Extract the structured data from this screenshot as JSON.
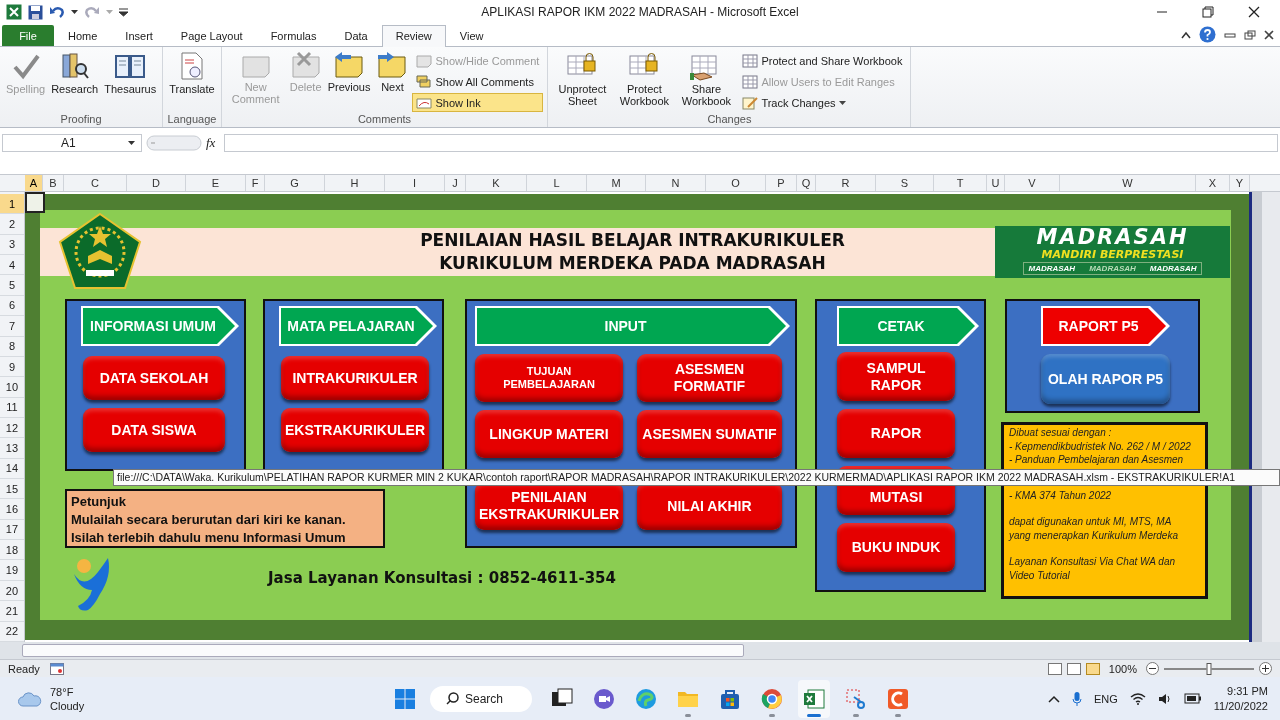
{
  "window": {
    "title": "APLIKASI RAPOR IKM 2022 MADRASAH  -  Microsoft Excel"
  },
  "ribbon": {
    "tabs": [
      {
        "label": "File",
        "kind": "file",
        "selected": false
      },
      {
        "label": "Home",
        "kind": "tab",
        "selected": false
      },
      {
        "label": "Insert",
        "kind": "tab",
        "selected": false
      },
      {
        "label": "Page Layout",
        "kind": "tab",
        "selected": false
      },
      {
        "label": "Formulas",
        "kind": "tab",
        "selected": false
      },
      {
        "label": "Data",
        "kind": "tab",
        "selected": false
      },
      {
        "label": "Review",
        "kind": "tab",
        "selected": true
      },
      {
        "label": "View",
        "kind": "tab",
        "selected": false
      }
    ],
    "groups": [
      {
        "label": "Proofing",
        "items": [
          {
            "label": "Spelling",
            "kind": "large",
            "disabled": true,
            "on": false
          },
          {
            "label": "Research",
            "kind": "large",
            "disabled": false,
            "on": false
          },
          {
            "label": "Thesaurus",
            "kind": "large",
            "disabled": false,
            "on": false
          }
        ]
      },
      {
        "label": "Language",
        "items": [
          {
            "label": "Translate",
            "kind": "large",
            "disabled": false,
            "on": false
          }
        ]
      },
      {
        "label": "Comments",
        "items": [
          {
            "label": "New Comment",
            "kind": "large",
            "disabled": true,
            "on": false
          },
          {
            "label": "Delete",
            "kind": "large",
            "disabled": true,
            "on": false
          },
          {
            "label": "Previous",
            "kind": "large",
            "disabled": false,
            "on": false
          },
          {
            "label": "Next",
            "kind": "large",
            "disabled": false,
            "on": false
          },
          {
            "label": "Show/Hide Comment",
            "kind": "small",
            "disabled": true,
            "on": false
          },
          {
            "label": "Show All Comments",
            "kind": "small",
            "disabled": false,
            "on": false
          },
          {
            "label": "Show Ink",
            "kind": "small",
            "disabled": false,
            "on": true
          }
        ]
      },
      {
        "label": "Changes",
        "items": [
          {
            "label": "Unprotect Sheet",
            "kind": "large",
            "disabled": false,
            "on": false
          },
          {
            "label": "Protect Workbook",
            "kind": "large",
            "disabled": false,
            "on": false
          },
          {
            "label": "Share Workbook",
            "kind": "large",
            "disabled": false,
            "on": false
          },
          {
            "label": "Protect and Share Workbook",
            "kind": "small",
            "disabled": false,
            "on": false
          },
          {
            "label": "Allow Users to Edit Ranges",
            "kind": "small",
            "disabled": true,
            "on": false
          },
          {
            "label": "Track Changes",
            "kind": "dropdown",
            "disabled": false,
            "on": false
          }
        ]
      }
    ]
  },
  "formula_bar": {
    "name_box": "A1",
    "function_label": "fx"
  },
  "sheet": {
    "columns": [
      {
        "label": "A",
        "selected": true
      },
      {
        "label": "B",
        "selected": false
      },
      {
        "label": "C",
        "selected": false
      },
      {
        "label": "D",
        "selected": false
      },
      {
        "label": "E",
        "selected": false
      },
      {
        "label": "F",
        "selected": false
      },
      {
        "label": "G",
        "selected": false
      },
      {
        "label": "H",
        "selected": false
      },
      {
        "label": "I",
        "selected": false
      },
      {
        "label": "J",
        "selected": false
      },
      {
        "label": "K",
        "selected": false
      },
      {
        "label": "L",
        "selected": false
      },
      {
        "label": "M",
        "selected": false
      },
      {
        "label": "N",
        "selected": false
      },
      {
        "label": "O",
        "selected": false
      },
      {
        "label": "P",
        "selected": false
      },
      {
        "label": "Q",
        "selected": false
      },
      {
        "label": "R",
        "selected": false
      },
      {
        "label": "S",
        "selected": false
      },
      {
        "label": "T",
        "selected": false
      },
      {
        "label": "U",
        "selected": false
      },
      {
        "label": "V",
        "selected": false
      },
      {
        "label": "W",
        "selected": false
      },
      {
        "label": "X",
        "selected": false
      },
      {
        "label": "Y",
        "selected": false
      }
    ],
    "rows": [
      {
        "label": "1",
        "selected": true
      },
      {
        "label": "2",
        "selected": false
      },
      {
        "label": "3",
        "selected": false
      },
      {
        "label": "4",
        "selected": false
      },
      {
        "label": "5",
        "selected": false
      },
      {
        "label": "6",
        "selected": false
      },
      {
        "label": "7",
        "selected": false
      },
      {
        "label": "8",
        "selected": false
      },
      {
        "label": "9",
        "selected": false
      },
      {
        "label": "10",
        "selected": false
      },
      {
        "label": "11",
        "selected": false
      },
      {
        "label": "12",
        "selected": false
      },
      {
        "label": "13",
        "selected": false
      },
      {
        "label": "14",
        "selected": false
      },
      {
        "label": "15",
        "selected": false
      },
      {
        "label": "16",
        "selected": false
      },
      {
        "label": "17",
        "selected": false
      },
      {
        "label": "18",
        "selected": false
      },
      {
        "label": "19",
        "selected": false
      },
      {
        "label": "20",
        "selected": false
      },
      {
        "label": "21",
        "selected": false
      },
      {
        "label": "22",
        "selected": false
      }
    ]
  },
  "dashboard": {
    "title_lines": [
      "PENILAIAN HASIL BELAJAR INTRAKURIKULER",
      "KURIKULUM MERDEKA PADA MADRASAH"
    ],
    "banner": {
      "title": "MADRASAH",
      "subtitle": "MANDIRI BERPRESTASI",
      "strip": [
        "MADRASAH",
        "MADRASAH",
        "MADRASAH"
      ]
    },
    "panels": [
      {
        "header": {
          "label": "INFORMASI  UMUM",
          "color": "#00a651"
        },
        "buttons": [
          {
            "label": "DATA SEKOLAH",
            "color": "#e50000"
          },
          {
            "label": "DATA SISWA",
            "color": "#e50000"
          }
        ]
      },
      {
        "header": {
          "label": "MATA PELAJARAN",
          "color": "#00a651"
        },
        "buttons": [
          {
            "label": "INTRAKURIKULER",
            "color": "#e50000"
          },
          {
            "label": "EKSTRAKURIKULER",
            "color": "#e50000"
          }
        ]
      },
      {
        "header": {
          "label": "INPUT",
          "color": "#00a651"
        },
        "buttons": [
          {
            "label": "TUJUAN PEMBELAJARAN",
            "color": "#e50000"
          },
          {
            "label": "ASESMEN FORMATIF",
            "color": "#e50000"
          },
          {
            "label": "LINGKUP MATERI",
            "color": "#e50000"
          },
          {
            "label": "ASESMEN SUMATIF",
            "color": "#e50000"
          },
          {
            "label": "PENILAIAN EKSTRAKURIKULER",
            "color": "#e50000"
          },
          {
            "label": "NILAI AKHIR",
            "color": "#e50000"
          }
        ]
      },
      {
        "header": {
          "label": "CETAK",
          "color": "#00a651"
        },
        "buttons": [
          {
            "label": "SAMPUL RAPOR",
            "color": "#e50000"
          },
          {
            "label": "RAPOR",
            "color": "#e50000"
          },
          {
            "label": "MUTASI",
            "color": "#e50000"
          },
          {
            "label": "BUKU INDUK",
            "color": "#e50000"
          }
        ]
      },
      {
        "header": {
          "label": "RAPORT P5",
          "color": "#ee0000"
        },
        "buttons": [
          {
            "label": "OLAH RAPOR P5",
            "color": "#2f72c4"
          }
        ]
      }
    ],
    "hint": {
      "title": "Petunjuk",
      "lines": [
        "Mulailah secara berurutan dari kiri ke kanan.",
        "Isilah terlebih dahulu menu Informasi Umum"
      ]
    },
    "contact": "Jasa Layanan Konsultasi : 0852-4611-354",
    "note": {
      "paragraphs": [
        [
          "Dibuat sesuai dengan :",
          "- Kepmendikbudristek  No. 262 / M / 2022",
          "- Panduan Pembelajaran  dan Asesmen"
        ],
        [
          "- KMA 374 Tahun 2022"
        ],
        [
          "dapat digunakan  untuk MI, MTS, MA",
          "yang menerapkan Kurikulum Merdeka"
        ],
        [
          "Layanan Konsultasi Via Chat WA dan",
          "Video Tutorial"
        ]
      ]
    }
  },
  "link_tooltip": "file:///C:\\DATA\\Waka. Kurikulum\\PELATIHAN RAPOR KURMER MIN 2 KUKAR\\contoh raport\\RAPOR MADRASAH\\RAPOR INTRAKURIKULER\\2022 KURMERMAD\\APLIKASI RAPOR IKM 2022 MADRASAH.xlsm - EKSTRAKURIKULER!A1",
  "status_bar": {
    "status": "Ready",
    "views": [
      {
        "selected": false
      },
      {
        "selected": false
      },
      {
        "selected": true
      }
    ],
    "zoom": "100%",
    "zoom_slider": {
      "level": 0.5
    }
  },
  "taskbar": {
    "weather": {
      "temp": "78°F",
      "condition": "Cloudy"
    },
    "search": "Search",
    "apps": [
      {
        "running": false,
        "selected": false
      },
      {
        "running": false,
        "selected": false
      },
      {
        "running": false,
        "selected": false
      },
      {
        "running": true,
        "selected": false
      },
      {
        "running": false,
        "selected": false
      },
      {
        "running": true,
        "selected": false
      },
      {
        "running": true,
        "selected": true
      },
      {
        "running": true,
        "selected": false
      },
      {
        "running": true,
        "selected": false
      }
    ],
    "language": "ENG",
    "time": "9:31 PM",
    "date": "11/20/2022"
  }
}
